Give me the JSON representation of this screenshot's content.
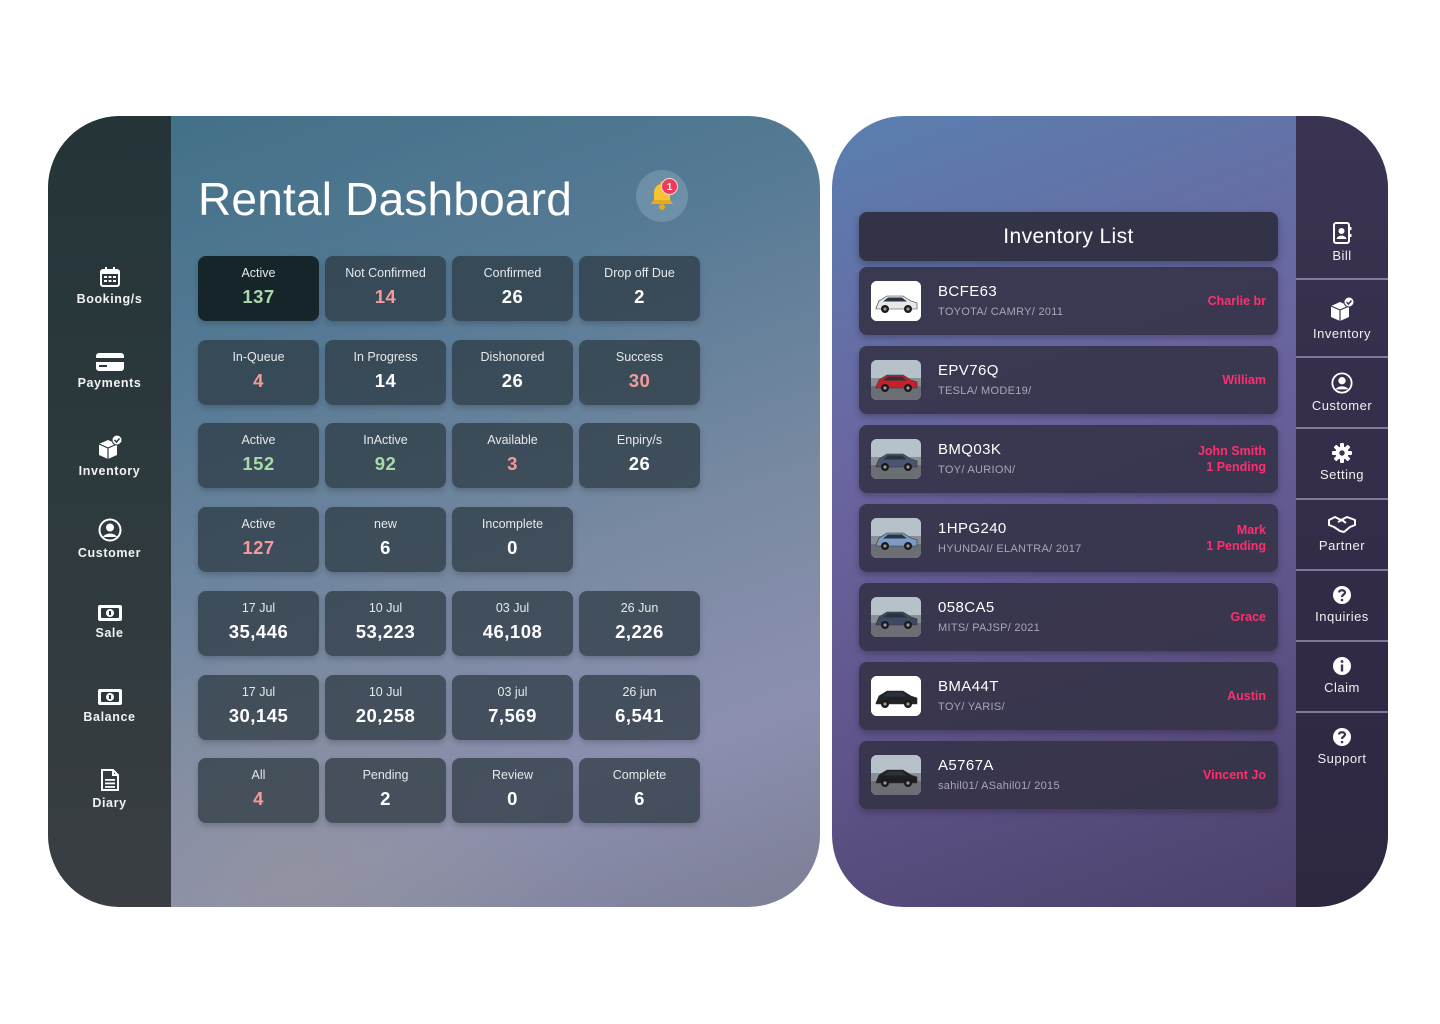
{
  "dashboard": {
    "title": "Rental Dashboard",
    "notification_count": "1",
    "sidebar": [
      {
        "label": "Booking/s",
        "icon": "calendar-icon"
      },
      {
        "label": "Payments",
        "icon": "credit-card-icon"
      },
      {
        "label": "Inventory",
        "icon": "box-check-icon"
      },
      {
        "label": "Customer",
        "icon": "user-circle-icon"
      },
      {
        "label": "Sale",
        "icon": "money-bill-icon"
      },
      {
        "label": "Balance",
        "icon": "money-bill-icon"
      },
      {
        "label": "Diary",
        "icon": "document-icon"
      }
    ],
    "tiles": [
      [
        {
          "label": "Active",
          "value": "137",
          "tone": "green"
        },
        {
          "label": "Not Confirmed",
          "value": "14",
          "tone": "pink"
        },
        {
          "label": "Confirmed",
          "value": "26",
          "tone": "white"
        },
        {
          "label": "Drop off Due",
          "value": "2",
          "tone": "white"
        }
      ],
      [
        {
          "label": "In-Queue",
          "value": "4",
          "tone": "pink"
        },
        {
          "label": "In Progress",
          "value": "14",
          "tone": "white"
        },
        {
          "label": "Dishonored",
          "value": "26",
          "tone": "white"
        },
        {
          "label": "Success",
          "value": "30",
          "tone": "pink"
        }
      ],
      [
        {
          "label": "Active",
          "value": "152",
          "tone": "green"
        },
        {
          "label": "InActive",
          "value": "92",
          "tone": "green"
        },
        {
          "label": "Available",
          "value": "3",
          "tone": "pink"
        },
        {
          "label": "Enpiry/s",
          "value": "26",
          "tone": "white"
        }
      ],
      [
        {
          "label": "Active",
          "value": "127",
          "tone": "pink"
        },
        {
          "label": "new",
          "value": "6",
          "tone": "white"
        },
        {
          "label": "Incomplete",
          "value": "0",
          "tone": "white"
        }
      ],
      [
        {
          "label": "17 Jul",
          "value": "35,446",
          "tone": "white"
        },
        {
          "label": "10 Jul",
          "value": "53,223",
          "tone": "white"
        },
        {
          "label": "03 Jul",
          "value": "46,108",
          "tone": "white"
        },
        {
          "label": "26 Jun",
          "value": "2,226",
          "tone": "white"
        }
      ],
      [
        {
          "label": "17 Jul",
          "value": "30,145",
          "tone": "white"
        },
        {
          "label": "10 Jul",
          "value": "20,258",
          "tone": "white"
        },
        {
          "label": "03 jul",
          "value": "7,569",
          "tone": "white"
        },
        {
          "label": "26 jun",
          "value": "6,541",
          "tone": "white"
        }
      ],
      [
        {
          "label": "All",
          "value": "4",
          "tone": "pink"
        },
        {
          "label": "Pending",
          "value": "2",
          "tone": "white"
        },
        {
          "label": "Review",
          "value": "0",
          "tone": "white"
        },
        {
          "label": "Complete",
          "value": "6",
          "tone": "white"
        }
      ]
    ]
  },
  "inventory": {
    "title": "Inventory List",
    "items": [
      {
        "plate": "BCFE63",
        "model": "TOYOTA/ CAMRY/ 2011",
        "owner": "Charlie br",
        "owner2": "",
        "car_color": "#e8e8ec"
      },
      {
        "plate": "EPV76Q",
        "model": "TESLA/ MODE19/",
        "owner": "William",
        "owner2": "",
        "car_color": "#c8202a"
      },
      {
        "plate": "BMQ03K",
        "model": "TOY/ AURION/",
        "owner": "John Smith",
        "owner2": "1 Pending",
        "car_color": "#4a5570"
      },
      {
        "plate": "1HPG240",
        "model": "HYUNDAI/ ELANTRA/ 2017",
        "owner": "Mark",
        "owner2": "1 Pending",
        "car_color": "#7a9cc6"
      },
      {
        "plate": "058CA5",
        "model": "MITS/ PAJSP/ 2021",
        "owner": "Grace",
        "owner2": "",
        "car_color": "#3c4a66"
      },
      {
        "plate": "BMA44T",
        "model": "TOY/ YARIS/",
        "owner": "Austin",
        "owner2": "",
        "car_color": "#222222"
      },
      {
        "plate": "A5767A",
        "model": "sahil01/ ASahil01/ 2015",
        "owner": "Vincent Jo",
        "owner2": "",
        "car_color": "#1e1e22"
      }
    ],
    "sidebar": [
      {
        "label": "Bill",
        "icon": "contact-book-icon"
      },
      {
        "label": "Inventory",
        "icon": "box-check-icon"
      },
      {
        "label": "Customer",
        "icon": "user-circle-icon"
      },
      {
        "label": "Setting",
        "icon": "gear-icon"
      },
      {
        "label": "Partner",
        "icon": "handshake-icon"
      },
      {
        "label": "Inquiries",
        "icon": "question-circle-icon"
      },
      {
        "label": "Claim",
        "icon": "info-circle-icon"
      },
      {
        "label": "Support",
        "icon": "question-circle-icon"
      }
    ]
  },
  "colors": {
    "value_green": "#a8dba8",
    "value_pink": "#f59a9a",
    "owner_pink": "#ff2e6e",
    "badge_red": "#ef3b57"
  }
}
